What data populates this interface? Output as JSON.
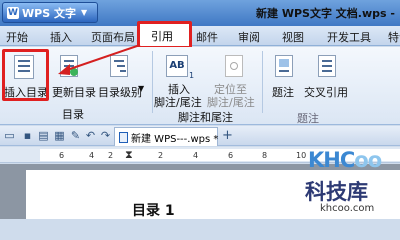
{
  "titlebar": {
    "app_button": "WPS 文字",
    "logo": "W",
    "window_title": "新建 WPS文字 文档.wps -"
  },
  "tabs": [
    "开始",
    "插入",
    "页面布局",
    "引用",
    "邮件",
    "审阅",
    "视图",
    "开发工具",
    "特色"
  ],
  "active_tab": "引用",
  "ribbon": {
    "insert_toc": "插入目录",
    "update_toc": "更新目录",
    "toc_level": "目录级别",
    "toc_group": "目录",
    "insert_footnote_l1": "插入",
    "insert_footnote_l2": "脚注/尾注",
    "locate_footnote_l1": "定位至",
    "locate_footnote_l2": "脚注/尾注",
    "footnote_group": "脚注和尾注",
    "caption": "题注",
    "cross_ref": "交叉引用",
    "caption_group": "题注",
    "ab_icon": "AB",
    "ab_sub": "1"
  },
  "doc_tab": {
    "label": "新建 WPS---.wps *"
  },
  "ruler": {
    "ticks": [
      "6",
      "4",
      "2",
      "2",
      "4",
      "6",
      "8",
      "10"
    ]
  },
  "document": {
    "heading": "目录 1"
  },
  "watermark": {
    "brand_a": "KHC",
    "brand_b": "oo",
    "cn": "科技库",
    "url": "khcoo.com"
  },
  "colors": {
    "highlight": "#e02020",
    "accent": "#3f78c4"
  }
}
